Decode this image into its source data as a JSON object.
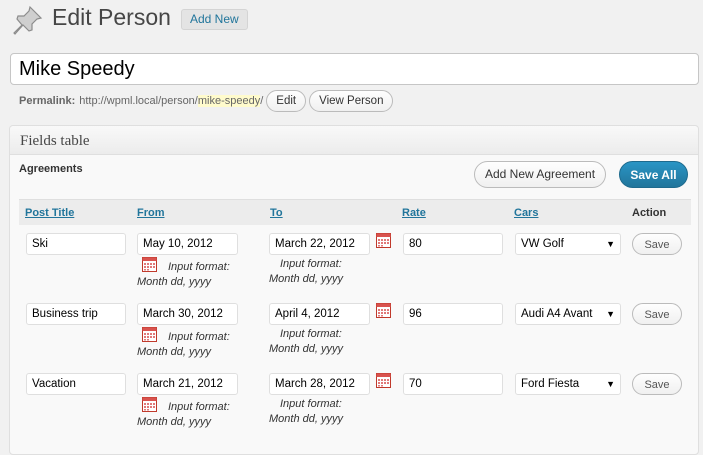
{
  "header": {
    "title": "Edit Person",
    "add_new_label": "Add New"
  },
  "post": {
    "title": "Mike Speedy"
  },
  "permalink": {
    "label": "Permalink:",
    "base": "http://wpml.local/person/",
    "slug": "mike-speedy",
    "trail": "/",
    "edit_label": "Edit",
    "view_label": "View Person"
  },
  "box": {
    "title": "Fields table",
    "agreements_label": "Agreements"
  },
  "buttons": {
    "add_agreement": "Add New Agreement",
    "save_all": "Save All"
  },
  "columns": {
    "post_title": "Post Title",
    "from": "From",
    "to": "To",
    "rate": "Rate",
    "cars": "Cars",
    "action": "Action"
  },
  "hint": {
    "line1": "Input format:",
    "line2": "Month dd, yyyy"
  },
  "rows": [
    {
      "post_title": "Ski",
      "from": "May 10, 2012",
      "to": "March 22, 2012",
      "rate": "80",
      "car": "VW Golf",
      "save": "Save"
    },
    {
      "post_title": "Business trip",
      "from": "March 30, 2012",
      "to": "April 4, 2012",
      "rate": "96",
      "car": "Audi A4 Avant",
      "save": "Save"
    },
    {
      "post_title": "Vacation",
      "from": "March 21, 2012",
      "to": "March 28, 2012",
      "rate": "70",
      "car": "Ford Fiesta",
      "save": "Save"
    }
  ],
  "colors": {
    "link": "#21759b",
    "primary": "#21759b",
    "slug_highlight": "#fffbcc"
  }
}
